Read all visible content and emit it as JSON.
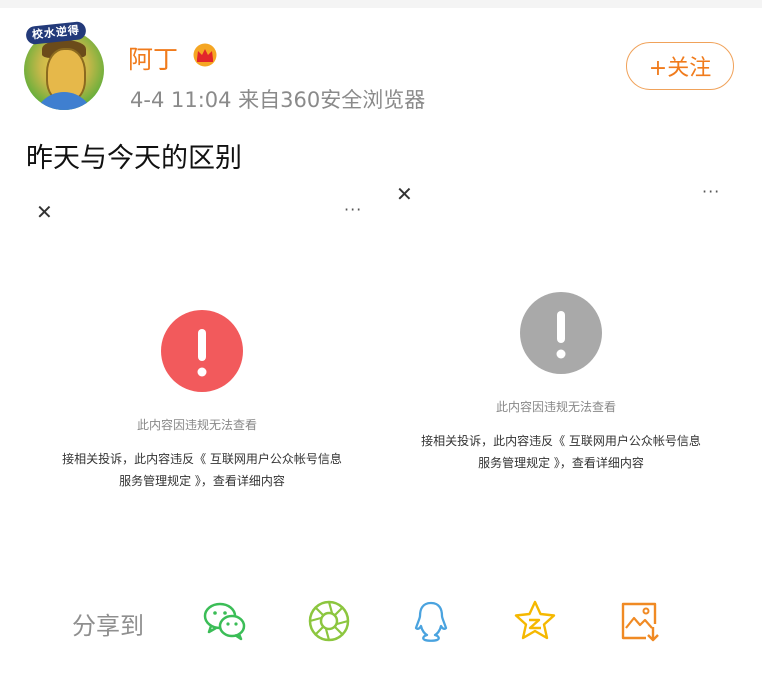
{
  "user": {
    "name": "阿丁",
    "badge_text": "校水逆得",
    "meta": "4-4 11:04  来自360安全浏览器",
    "follow_label": "+关注"
  },
  "post": {
    "text": "昨天与今天的区别"
  },
  "cards": [
    {
      "alert_color": "#f25a5c",
      "title": "此内容因违规无法查看",
      "desc_line1": "接相关投诉，此内容违反《 互联网用户公众帐号信息",
      "desc_line2": "服务管理规定 》，查看详细内容"
    },
    {
      "alert_color": "#a9a9a9",
      "title": "此内容因违规无法查看",
      "desc_line1": "接相关投诉，此内容违反《 互联网用户公众帐号信息",
      "desc_line2": "服务管理规定 》，查看详细内容"
    }
  ],
  "share": {
    "label": "分享到",
    "icons": [
      "wechat-icon",
      "moments-icon",
      "qq-icon",
      "qzone-icon",
      "save-image-icon"
    ],
    "colors": {
      "wechat": "#3bbd57",
      "moments": "#8cc63f",
      "qq": "#4aa3df",
      "qzone": "#f5b800",
      "save": "#f08a24"
    }
  },
  "colors": {
    "accent": "#f07b1c"
  }
}
